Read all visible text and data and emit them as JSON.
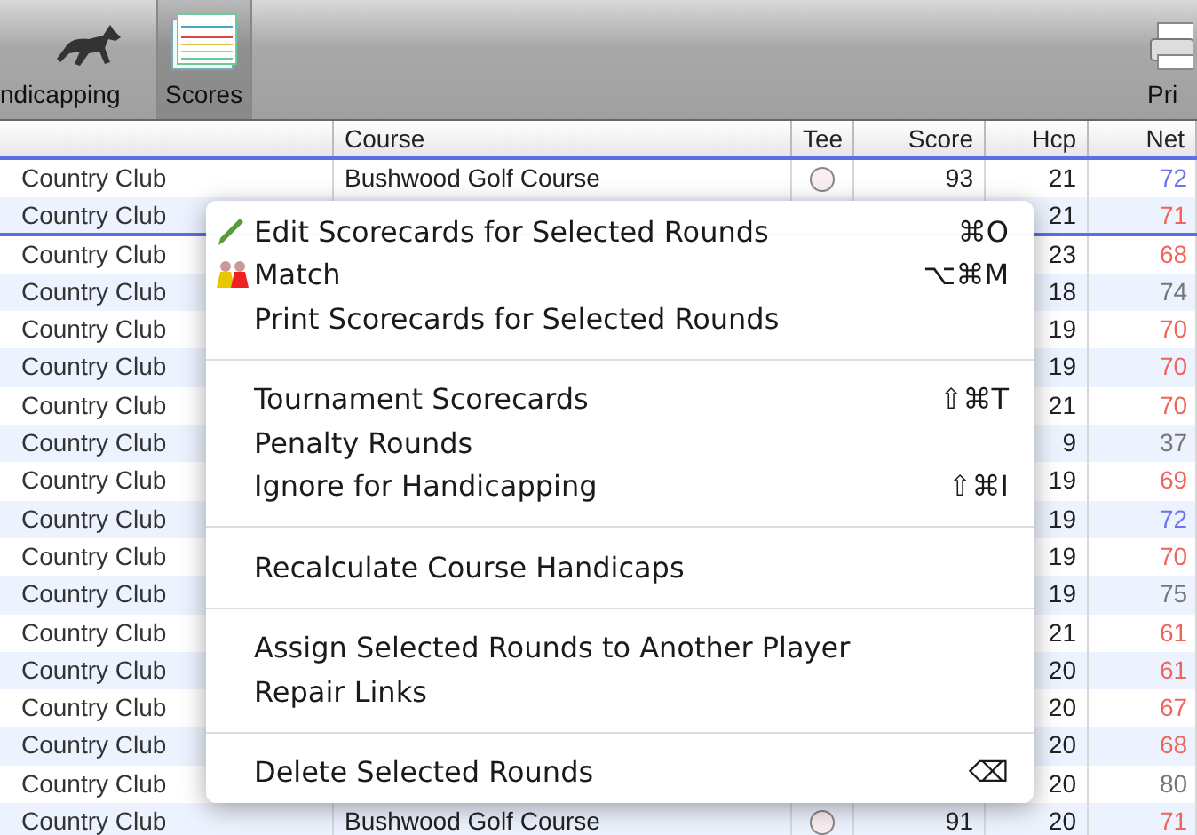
{
  "toolbar": {
    "items": [
      {
        "label": "ndicapping",
        "selected": false
      },
      {
        "label": "Scores",
        "selected": true
      },
      {
        "label": "Pri",
        "selected": false
      }
    ]
  },
  "table": {
    "columns": [
      "",
      "Course",
      "Tee",
      "Score",
      "Hcp",
      "Net"
    ],
    "rows": [
      {
        "column_1": "Country Club",
        "course": "Bushwood Golf Course",
        "tee": {
          "selected": false
        },
        "score": "93",
        "hcp": "21",
        "net": {
          "text": "72",
          "color": "#6b73f0"
        },
        "drop_line": false
      },
      {
        "column_1": "Country Club",
        "hcp": "21",
        "net": {
          "text": "71",
          "color": "#f0645a"
        },
        "drop_line": true
      },
      {
        "column_1": "Country Club",
        "hcp": "23",
        "net": {
          "text": "68",
          "color": "#f0645a"
        },
        "drop_line": false
      },
      {
        "column_1": "Country Club",
        "hcp": "18",
        "net": {
          "text": "74",
          "color": "#777777"
        },
        "drop_line": false
      },
      {
        "column_1": "Country Club",
        "hcp": "19",
        "net": {
          "text": "70",
          "color": "#f0645a"
        },
        "drop_line": false
      },
      {
        "column_1": "Country Club",
        "hcp": "19",
        "net": {
          "text": "70",
          "color": "#f0645a"
        },
        "drop_line": false
      },
      {
        "column_1": "Country Club",
        "hcp": "21",
        "net": {
          "text": "70",
          "color": "#f0645a"
        },
        "drop_line": false
      },
      {
        "column_1": "Country Club",
        "hcp": "9",
        "net": {
          "text": "37",
          "color": "#777777"
        },
        "drop_line": false
      },
      {
        "column_1": "Country Club",
        "hcp": "19",
        "net": {
          "text": "69",
          "color": "#f0645a"
        },
        "drop_line": false
      },
      {
        "column_1": "Country Club",
        "hcp": "19",
        "net": {
          "text": "72",
          "color": "#6b73f0"
        },
        "drop_line": false
      },
      {
        "column_1": "Country Club",
        "hcp": "19",
        "net": {
          "text": "70",
          "color": "#f0645a"
        },
        "drop_line": false
      },
      {
        "column_1": "Country Club",
        "hcp": "19",
        "net": {
          "text": "75",
          "color": "#777777"
        },
        "drop_line": false
      },
      {
        "column_1": "Country Club",
        "hcp": "21",
        "net": {
          "text": "61",
          "color": "#f0645a"
        },
        "drop_line": false
      },
      {
        "column_1": "Country Club",
        "hcp": "20",
        "net": {
          "text": "61",
          "color": "#f0645a"
        },
        "drop_line": false
      },
      {
        "column_1": "Country Club",
        "hcp": "20",
        "net": {
          "text": "67",
          "color": "#f0645a"
        },
        "drop_line": false
      },
      {
        "column_1": "Country Club",
        "hcp": "20",
        "net": {
          "text": "68",
          "color": "#f0645a"
        },
        "drop_line": false
      },
      {
        "column_1": "Country Club",
        "hcp": "20",
        "net": {
          "text": "80",
          "color": "#777777"
        },
        "drop_line": false
      },
      {
        "column_1": "Country Club",
        "course": "Bushwood Golf Course",
        "tee": {
          "selected": false
        },
        "score": "91",
        "hcp": "20",
        "net": {
          "text": "71",
          "color": "#f0645a"
        },
        "drop_line": false
      }
    ]
  },
  "context_menu": {
    "items": [
      {
        "kind": "item",
        "label": "Edit Scorecards for Selected Rounds",
        "shortcut": "⌘O"
      },
      {
        "kind": "item",
        "label": "Match",
        "shortcut": "⌥⌘M"
      },
      {
        "kind": "item",
        "label": "Print Scorecards for Selected Rounds"
      },
      {
        "kind": "separator"
      },
      {
        "kind": "item",
        "label": "Tournament Scorecards",
        "shortcut": "⇧⌘T"
      },
      {
        "kind": "item",
        "label": "Penalty Rounds"
      },
      {
        "kind": "item",
        "label": "Ignore for Handicapping",
        "shortcut": "⇧⌘I"
      },
      {
        "kind": "separator"
      },
      {
        "kind": "item",
        "label": "Recalculate Course Handicaps"
      },
      {
        "kind": "separator"
      },
      {
        "kind": "item",
        "label": "Assign Selected Rounds to Another Player"
      },
      {
        "kind": "item",
        "label": "Repair Links"
      },
      {
        "kind": "separator"
      },
      {
        "kind": "item",
        "label": "Delete Selected Rounds",
        "shortcut": "⌫"
      }
    ]
  }
}
